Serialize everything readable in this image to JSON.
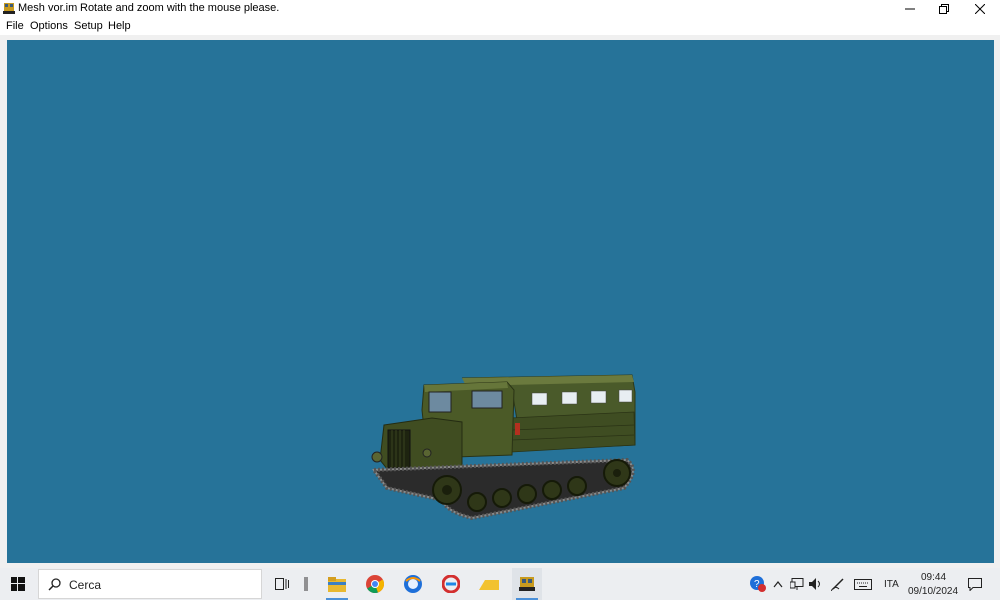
{
  "window": {
    "title": "Mesh vor.im",
    "subtitle": "Rotate and zoom with the mouse please.",
    "colors": {
      "viewport_bg": "#267399",
      "titlebar_bg": "#ffffff"
    }
  },
  "menu": {
    "items": [
      {
        "label": "File"
      },
      {
        "label": "Options"
      },
      {
        "label": "Setup"
      },
      {
        "label": "Help"
      }
    ]
  },
  "taskbar": {
    "search_placeholder": "Cerca",
    "apps": [
      "task-view-icon",
      "file-explorer-icon",
      "chrome-icon",
      "firefox-icon",
      "ccleaner-icon",
      "onedrive-folder-icon",
      "mesh-viewer-icon"
    ],
    "tray": {
      "language": "ITA",
      "time": "09:44",
      "date": "09/10/2024"
    }
  }
}
